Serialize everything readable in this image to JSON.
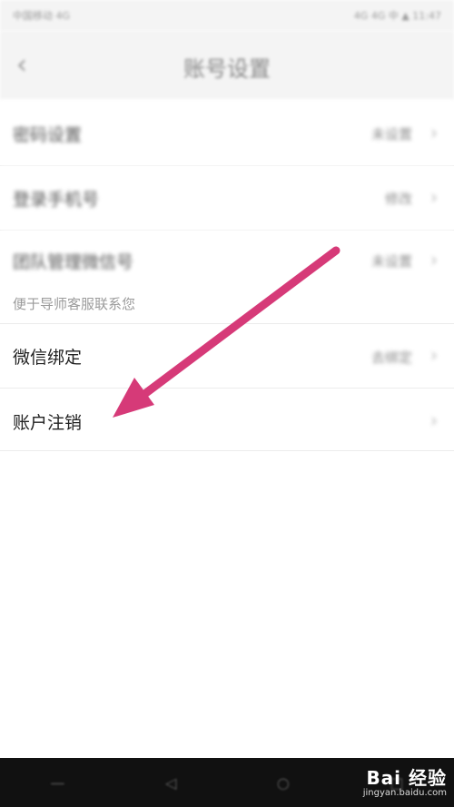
{
  "status_bar": {
    "left_text": "中国移动 4G",
    "right_text": "4G 4G 中 ▲ 11:47"
  },
  "header": {
    "back_icon": "chevron-left-icon",
    "title": "账号设置"
  },
  "rows": [
    {
      "label": "密码设置",
      "value": "未设置"
    },
    {
      "label": "登录手机号",
      "value": "修改"
    },
    {
      "label": "团队管理微信号",
      "value": "未设置"
    },
    {
      "label": "微信绑定",
      "value": "去绑定"
    },
    {
      "label": "账户注销",
      "value": ""
    }
  ],
  "hint": "便于导师客服联系您",
  "watermark": {
    "brand": "Bai 经验",
    "url": "jingyan.baidu.com"
  },
  "colors": {
    "arrow": "#d63a78",
    "background": "#ffffff",
    "bottom_bar": "#111111"
  }
}
